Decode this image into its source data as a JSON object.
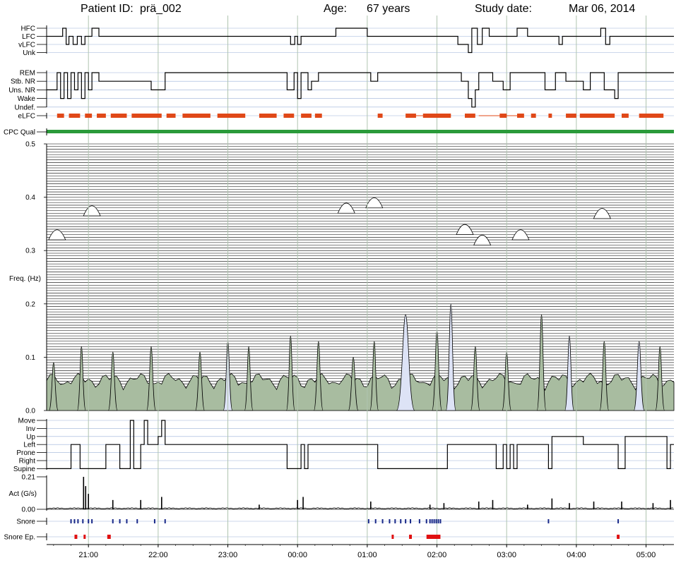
{
  "header": {
    "patient_label": "Patient ID:",
    "patient_id": "prä_002",
    "age_label": "Age:",
    "age_value": "67 years",
    "study_label": "Study date:",
    "study_date": "Mar 06, 2014"
  },
  "colors": {
    "grid_vertical": "#b0c4b0",
    "grid_blue": "#9ab0d8",
    "stair_line": "#000000",
    "elfc": "#e04818",
    "cpc_qual": "#2a9a3a",
    "spectrum_lavender": "#dde3f6",
    "spectrum_green": "#a8bca0",
    "snore": "#1a2a8a",
    "snore_episode": "#e01010"
  },
  "chart_data": [
    {
      "type": "line",
      "panel": "cpc_state",
      "levels": [
        "HFC",
        "LFC",
        "vLFC",
        "Unk"
      ],
      "x_range_hours": [
        20.4,
        29.4
      ],
      "state_sequence": [
        [
          20.4,
          "LFC"
        ],
        [
          20.55,
          "LFC"
        ],
        [
          20.63,
          "HFC"
        ],
        [
          20.68,
          "vLFC"
        ],
        [
          20.72,
          "LFC"
        ],
        [
          20.78,
          "vLFC"
        ],
        [
          20.84,
          "LFC"
        ],
        [
          20.9,
          "vLFC"
        ],
        [
          20.95,
          "LFC"
        ],
        [
          21.05,
          "HFC"
        ],
        [
          21.15,
          "LFC"
        ],
        [
          23.9,
          "vLFC"
        ],
        [
          23.96,
          "LFC"
        ],
        [
          24.0,
          "vLFC"
        ],
        [
          24.05,
          "LFC"
        ],
        [
          24.55,
          "HFC"
        ],
        [
          25.0,
          "LFC"
        ],
        [
          25.3,
          "LFC"
        ],
        [
          26.3,
          "vLFC"
        ],
        [
          26.45,
          "Unk"
        ],
        [
          26.5,
          "HFC"
        ],
        [
          26.58,
          "vLFC"
        ],
        [
          26.65,
          "HFC"
        ],
        [
          26.75,
          "LFC"
        ],
        [
          27.15,
          "HFC"
        ],
        [
          27.3,
          "LFC"
        ],
        [
          27.6,
          "LFC"
        ],
        [
          27.75,
          "vLFC"
        ],
        [
          27.8,
          "LFC"
        ],
        [
          28.35,
          "HFC"
        ],
        [
          28.42,
          "vLFC"
        ],
        [
          28.48,
          "LFC"
        ],
        [
          29.4,
          "LFC"
        ]
      ]
    },
    {
      "type": "line",
      "panel": "sleep_stage",
      "levels": [
        "REM",
        "Stb. NR",
        "Uns. NR",
        "Wake",
        "Undef."
      ],
      "state_sequence": [
        [
          20.4,
          "Uns. NR"
        ],
        [
          20.55,
          "REM"
        ],
        [
          20.6,
          "Wake"
        ],
        [
          20.65,
          "REM"
        ],
        [
          20.7,
          "Wake"
        ],
        [
          20.75,
          "REM"
        ],
        [
          20.8,
          "Uns. NR"
        ],
        [
          20.85,
          "REM"
        ],
        [
          20.9,
          "Wake"
        ],
        [
          20.95,
          "REM"
        ],
        [
          21.0,
          "Uns. NR"
        ],
        [
          21.05,
          "REM"
        ],
        [
          21.15,
          "Stb. NR"
        ],
        [
          21.9,
          "Uns. NR"
        ],
        [
          22.1,
          "REM"
        ],
        [
          23.85,
          "Uns. NR"
        ],
        [
          23.95,
          "REM"
        ],
        [
          24.0,
          "Wake"
        ],
        [
          24.05,
          "REM"
        ],
        [
          24.15,
          "Uns. NR"
        ],
        [
          24.2,
          "Stb. NR"
        ],
        [
          24.3,
          "REM"
        ],
        [
          25.05,
          "Stb. NR"
        ],
        [
          25.15,
          "REM"
        ],
        [
          26.35,
          "Stb. NR"
        ],
        [
          26.45,
          "Wake"
        ],
        [
          26.5,
          "Undef."
        ],
        [
          26.55,
          "Uns. NR"
        ],
        [
          26.6,
          "REM"
        ],
        [
          26.8,
          "Stb. NR"
        ],
        [
          26.95,
          "Uns. NR"
        ],
        [
          27.05,
          "REM"
        ],
        [
          27.55,
          "Uns. NR"
        ],
        [
          27.7,
          "REM"
        ],
        [
          27.85,
          "Stb. NR"
        ],
        [
          28.1,
          "Uns. NR"
        ],
        [
          28.2,
          "REM"
        ],
        [
          28.4,
          "Uns. NR"
        ],
        [
          28.55,
          "Wake"
        ],
        [
          28.6,
          "REM"
        ],
        [
          29.4,
          "REM"
        ]
      ]
    },
    {
      "type": "heatmap",
      "panel": "eLFC_and_quality",
      "labels": [
        "eLFC",
        "CPC Qual"
      ],
      "elfc_segments_hours": [
        [
          20.55,
          20.65
        ],
        [
          20.72,
          20.88
        ],
        [
          20.95,
          21.05
        ],
        [
          21.12,
          21.25
        ],
        [
          21.32,
          21.55
        ],
        [
          21.62,
          22.05
        ],
        [
          22.12,
          22.25
        ],
        [
          22.35,
          22.75
        ],
        [
          22.85,
          23.25
        ],
        [
          23.45,
          23.7
        ],
        [
          23.8,
          23.95
        ],
        [
          24.05,
          24.2
        ],
        [
          24.25,
          24.35
        ],
        [
          25.15,
          25.22
        ],
        [
          25.55,
          25.7
        ],
        [
          25.8,
          26.2
        ],
        [
          26.4,
          26.55
        ],
        [
          26.9,
          27.0
        ],
        [
          27.15,
          27.25
        ],
        [
          27.35,
          27.42
        ],
        [
          27.6,
          27.65
        ],
        [
          27.85,
          28.0
        ],
        [
          28.05,
          28.55
        ],
        [
          28.65,
          28.75
        ],
        [
          28.9,
          29.25
        ]
      ],
      "cpc_quality": "good"
    },
    {
      "type": "area",
      "panel": "cardiopulmonary_spectrogram",
      "ylabel": "Freq. (Hz)",
      "ylim": [
        0.0,
        0.5
      ],
      "yticks": [
        0.0,
        0.1,
        0.2,
        0.3,
        0.4,
        0.5
      ],
      "x_range_hours": [
        20.4,
        29.4
      ],
      "spectral_peaks": [
        {
          "t": 20.5,
          "f": 0.09,
          "w": 0.05,
          "fill": "green"
        },
        {
          "t": 20.9,
          "f": 0.12,
          "w": 0.04,
          "fill": "green"
        },
        {
          "t": 21.35,
          "f": 0.11,
          "w": 0.05,
          "fill": "green"
        },
        {
          "t": 21.9,
          "f": 0.12,
          "w": 0.05,
          "fill": "green"
        },
        {
          "t": 22.6,
          "f": 0.11,
          "w": 0.05,
          "fill": "green"
        },
        {
          "t": 23.0,
          "f": 0.13,
          "w": 0.05,
          "fill": "lavender"
        },
        {
          "t": 23.3,
          "f": 0.12,
          "w": 0.04,
          "fill": "green"
        },
        {
          "t": 23.9,
          "f": 0.14,
          "w": 0.04,
          "fill": "green"
        },
        {
          "t": 24.3,
          "f": 0.13,
          "w": 0.05,
          "fill": "green"
        },
        {
          "t": 24.8,
          "f": 0.1,
          "w": 0.06,
          "fill": "green"
        },
        {
          "t": 25.1,
          "f": 0.13,
          "w": 0.04,
          "fill": "green"
        },
        {
          "t": 25.55,
          "f": 0.18,
          "w": 0.18,
          "fill": "lavender"
        },
        {
          "t": 26.0,
          "f": 0.15,
          "w": 0.06,
          "fill": "green"
        },
        {
          "t": 26.2,
          "f": 0.2,
          "w": 0.06,
          "fill": "lavender"
        },
        {
          "t": 26.55,
          "f": 0.12,
          "w": 0.05,
          "fill": "green"
        },
        {
          "t": 27.0,
          "f": 0.11,
          "w": 0.05,
          "fill": "green"
        },
        {
          "t": 27.5,
          "f": 0.18,
          "w": 0.05,
          "fill": "green"
        },
        {
          "t": 27.9,
          "f": 0.14,
          "w": 0.05,
          "fill": "lavender"
        },
        {
          "t": 28.4,
          "f": 0.13,
          "w": 0.05,
          "fill": "green"
        },
        {
          "t": 28.9,
          "f": 0.13,
          "w": 0.07,
          "fill": "lavender"
        },
        {
          "t": 29.2,
          "f": 0.12,
          "w": 0.05,
          "fill": "green"
        }
      ],
      "high_freq_peaks": [
        {
          "t": 20.55,
          "f": 0.35
        },
        {
          "t": 21.05,
          "f": 0.395
        },
        {
          "t": 24.7,
          "f": 0.4
        },
        {
          "t": 25.1,
          "f": 0.41
        },
        {
          "t": 26.4,
          "f": 0.36
        },
        {
          "t": 26.65,
          "f": 0.34
        },
        {
          "t": 27.2,
          "f": 0.35
        },
        {
          "t": 28.37,
          "f": 0.39
        }
      ]
    },
    {
      "type": "line",
      "panel": "body_position",
      "levels": [
        "Move",
        "Inv",
        "Up",
        "Left",
        "Prone",
        "Right",
        "Supine"
      ],
      "state_sequence": [
        [
          20.4,
          "Supine"
        ],
        [
          20.75,
          "Left"
        ],
        [
          20.88,
          "Supine"
        ],
        [
          21.25,
          "Left"
        ],
        [
          21.45,
          "Supine"
        ],
        [
          21.6,
          "Move"
        ],
        [
          21.65,
          "Supine"
        ],
        [
          21.75,
          "Left"
        ],
        [
          21.8,
          "Move"
        ],
        [
          21.85,
          "Left"
        ],
        [
          22.0,
          "Up"
        ],
        [
          22.05,
          "Move"
        ],
        [
          22.1,
          "Left"
        ],
        [
          23.85,
          "Supine"
        ],
        [
          24.05,
          "Left"
        ],
        [
          24.1,
          "Supine"
        ],
        [
          24.15,
          "Left"
        ],
        [
          25.15,
          "Supine"
        ],
        [
          26.15,
          "Left"
        ],
        [
          26.85,
          "Supine"
        ],
        [
          26.95,
          "Left"
        ],
        [
          27.0,
          "Supine"
        ],
        [
          27.05,
          "Left"
        ],
        [
          27.1,
          "Supine"
        ],
        [
          27.15,
          "Left"
        ],
        [
          27.6,
          "Supine"
        ],
        [
          27.65,
          "Up"
        ],
        [
          28.1,
          "Left"
        ],
        [
          28.6,
          "Supine"
        ],
        [
          28.7,
          "Up"
        ],
        [
          29.3,
          "Supine"
        ],
        [
          29.35,
          "Left"
        ],
        [
          29.4,
          "Left"
        ]
      ]
    },
    {
      "type": "area",
      "panel": "actigraphy",
      "ylabel": "Act (G/s)",
      "ylim": [
        0.0,
        0.21
      ],
      "yticks": [
        0.0,
        0.21
      ],
      "bursts": [
        {
          "t": 20.93,
          "v": 0.21
        },
        {
          "t": 20.96,
          "v": 0.15
        },
        {
          "t": 21.0,
          "v": 0.1
        },
        {
          "t": 21.35,
          "v": 0.06
        },
        {
          "t": 21.75,
          "v": 0.06
        },
        {
          "t": 22.05,
          "v": 0.08
        },
        {
          "t": 23.45,
          "v": 0.03
        },
        {
          "t": 24.0,
          "v": 0.06
        },
        {
          "t": 24.08,
          "v": 0.08
        },
        {
          "t": 25.05,
          "v": 0.05
        },
        {
          "t": 25.9,
          "v": 0.03
        },
        {
          "t": 26.1,
          "v": 0.04
        },
        {
          "t": 26.6,
          "v": 0.05
        },
        {
          "t": 26.8,
          "v": 0.06
        },
        {
          "t": 27.3,
          "v": 0.03
        },
        {
          "t": 27.65,
          "v": 0.07
        },
        {
          "t": 27.9,
          "v": 0.04
        },
        {
          "t": 28.25,
          "v": 0.05
        },
        {
          "t": 28.65,
          "v": 0.05
        },
        {
          "t": 29.1,
          "v": 0.04
        },
        {
          "t": 29.35,
          "v": 0.06
        }
      ]
    },
    {
      "type": "scatter",
      "panel": "snore",
      "labels": [
        "Snore",
        "Snore Ep."
      ],
      "xtick_labels": [
        "21:00",
        "22:00",
        "23:00",
        "00:00",
        "01:00",
        "02:00",
        "03:00",
        "04:00",
        "05:00"
      ],
      "snore_times_hours": [
        20.75,
        20.8,
        20.85,
        20.92,
        21.0,
        21.05,
        21.35,
        21.45,
        21.55,
        21.7,
        21.95,
        22.1,
        25.02,
        25.12,
        25.22,
        25.32,
        25.4,
        25.48,
        25.55,
        25.62,
        25.75,
        25.85,
        25.9,
        25.93,
        25.96,
        25.99,
        26.02,
        26.05,
        27.6,
        28.6
      ],
      "snore_episode_segments_hours": [
        [
          20.8,
          20.84
        ],
        [
          20.93,
          20.96
        ],
        [
          21.27,
          21.32
        ],
        [
          25.35,
          25.38
        ],
        [
          25.6,
          25.64
        ],
        [
          25.85,
          26.05
        ],
        [
          28.58,
          28.62
        ]
      ]
    }
  ]
}
